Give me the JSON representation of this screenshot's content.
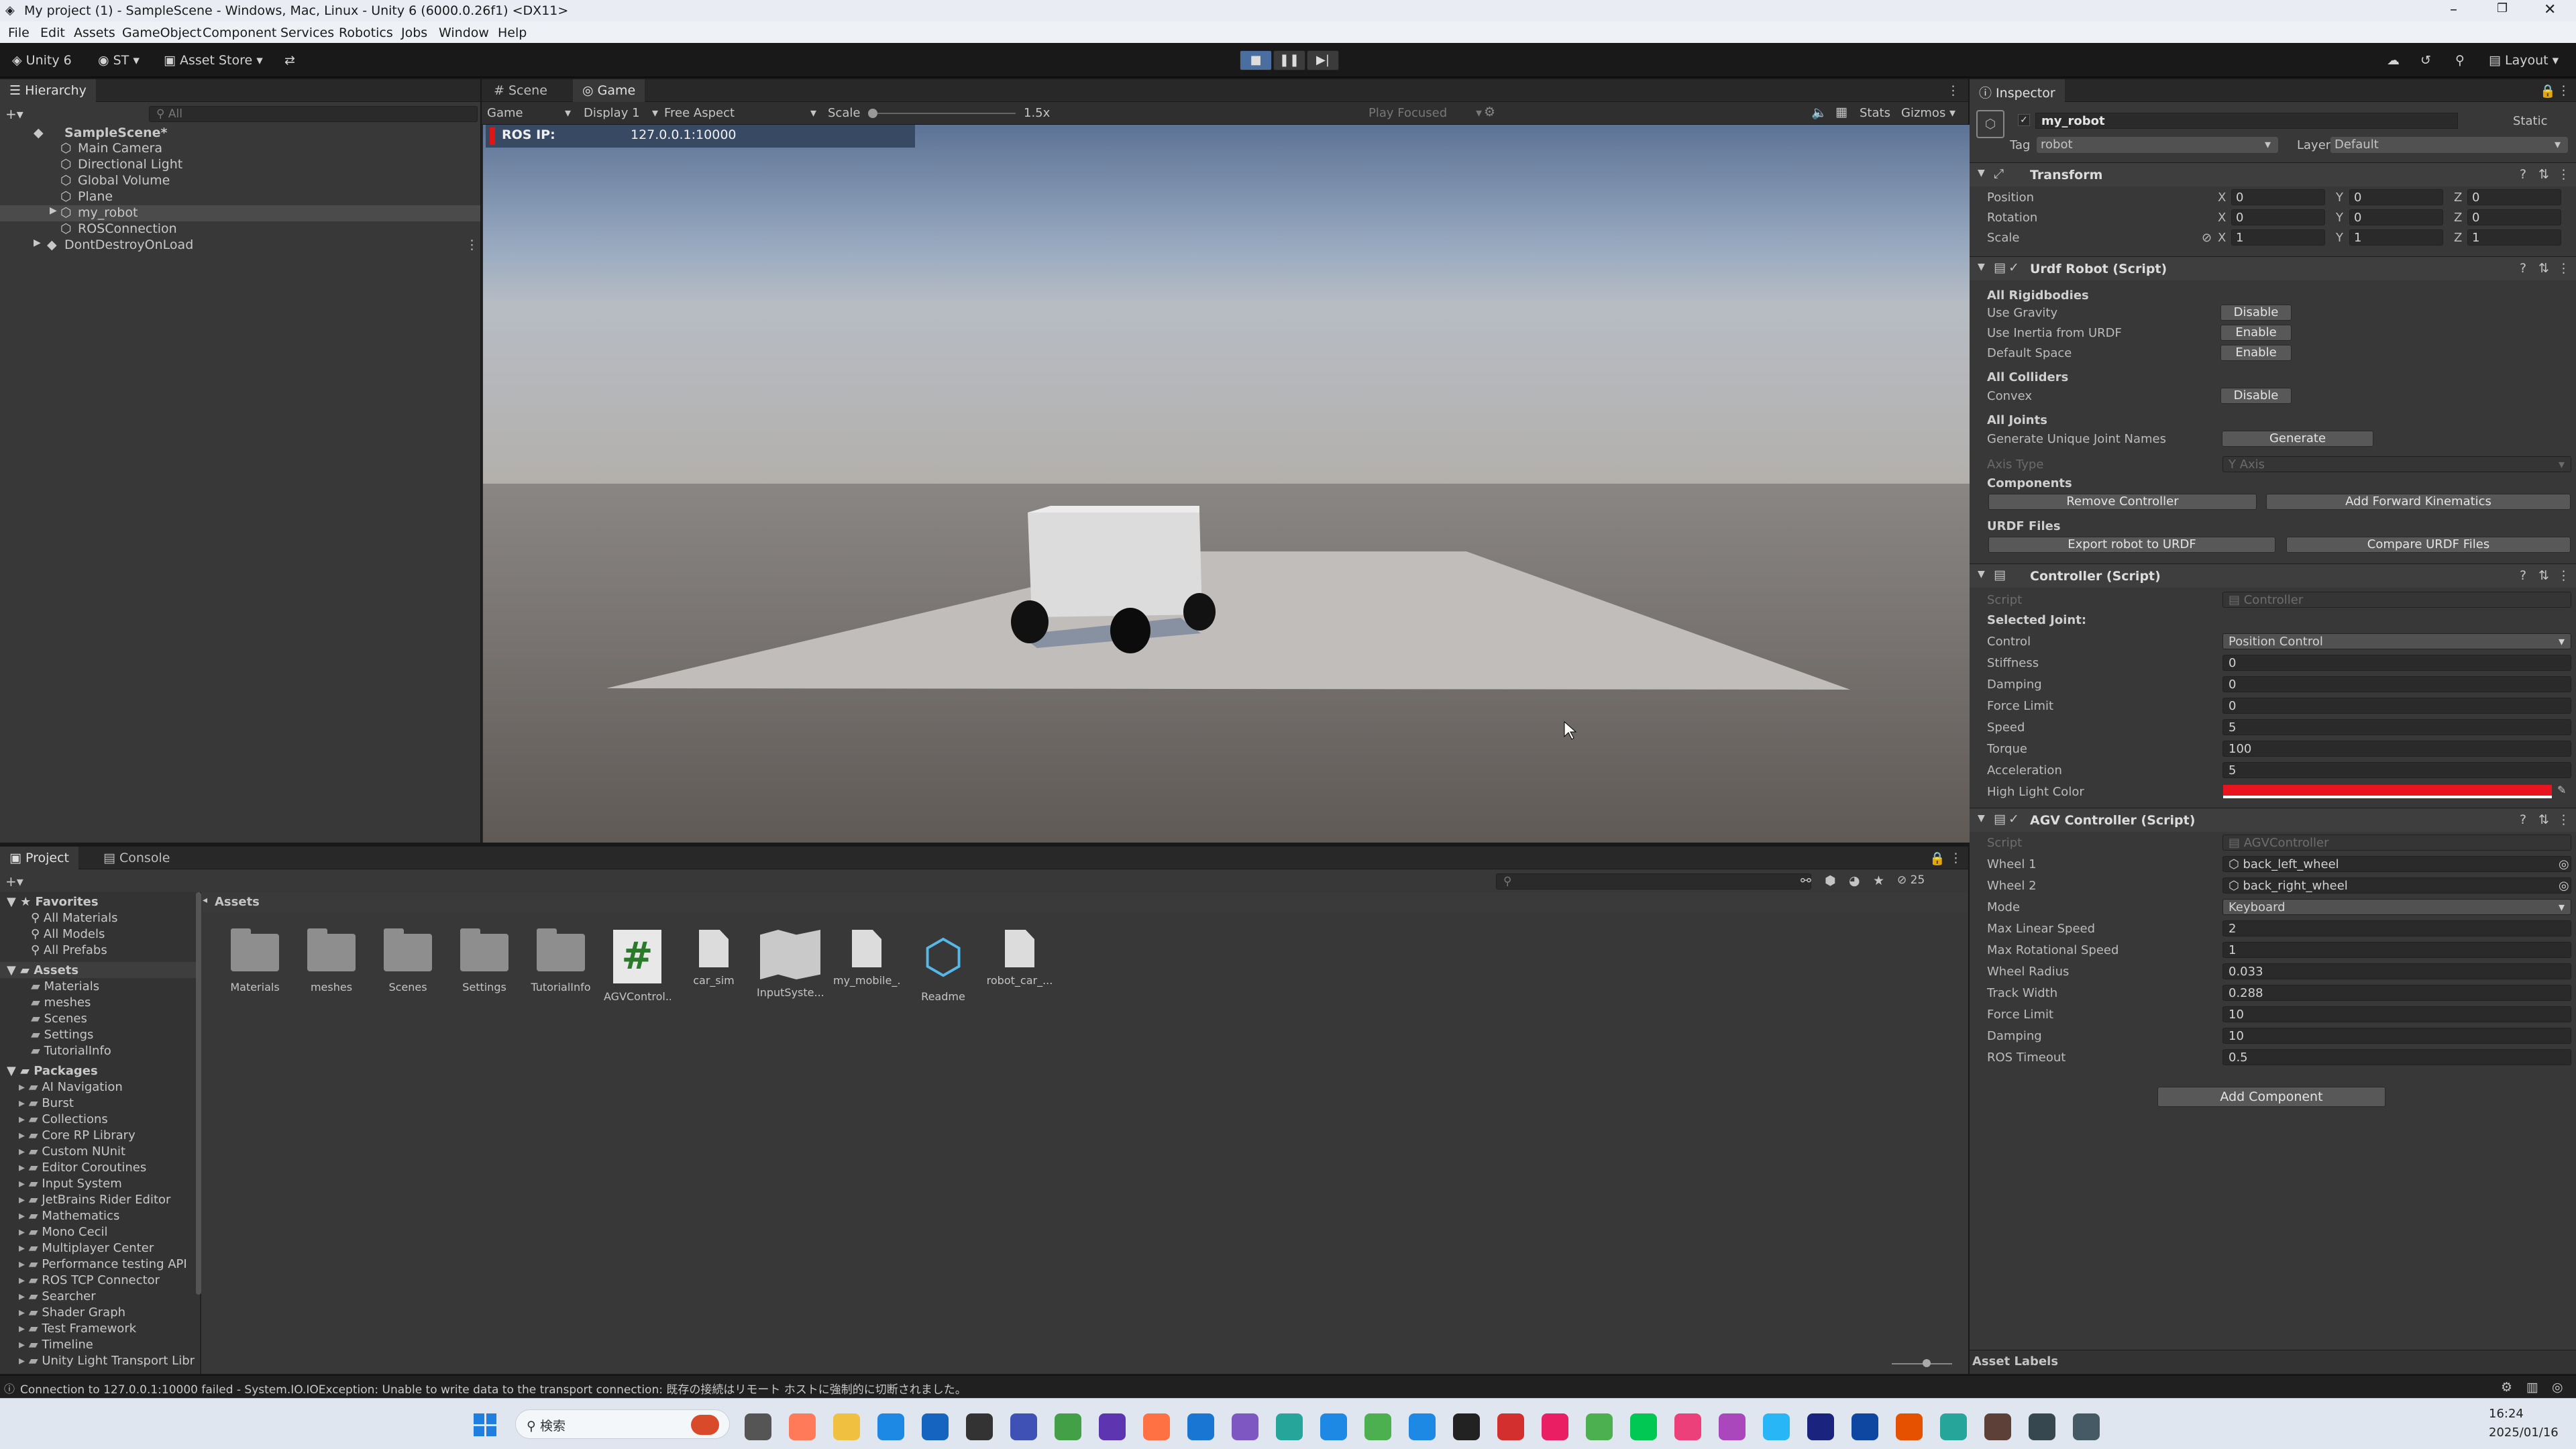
{
  "window": {
    "title": "My project (1) - SampleScene - Windows, Mac, Linux - Unity 6 (6000.0.26f1) <DX11>"
  },
  "menu": [
    "File",
    "Edit",
    "Assets",
    "GameObject",
    "Component",
    "Services",
    "Robotics",
    "Jobs",
    "Window",
    "Help"
  ],
  "toolbar": {
    "unity": "Unity 6",
    "account": "ST",
    "asset_store": "Asset Store",
    "layout": "Layout"
  },
  "hierarchy": {
    "tab": "Hierarchy",
    "search_placeholder": "All",
    "items": [
      {
        "label": "SampleScene*",
        "depth": 0
      },
      {
        "label": "Main Camera",
        "depth": 1
      },
      {
        "label": "Directional Light",
        "depth": 1
      },
      {
        "label": "Global Volume",
        "depth": 1
      },
      {
        "label": "Plane",
        "depth": 1
      },
      {
        "label": "my_robot",
        "depth": 1
      },
      {
        "label": "ROSConnection",
        "depth": 1
      },
      {
        "label": "DontDestroyOnLoad",
        "depth": 0
      }
    ]
  },
  "center": {
    "tabs": [
      "Scene",
      "Game"
    ],
    "game_mode": "Game",
    "display": "Display 1",
    "aspect": "Free Aspect",
    "scale_label": "Scale",
    "scale_value": "1.5x",
    "play_focused": "Play Focused",
    "stats": "Stats",
    "gizmos": "Gizmos",
    "ros_ip_label": "ROS IP:",
    "ros_ip_value": "127.0.0.1:10000"
  },
  "inspector": {
    "tab": "Inspector",
    "object_name": "my_robot",
    "static": "Static",
    "tag_label": "Tag",
    "tag": "robot",
    "layer_label": "Layer",
    "layer": "Default",
    "transform": {
      "title": "Transform",
      "position_label": "Position",
      "rotation_label": "Rotation",
      "scale_label": "Scale",
      "position": [
        "0",
        "0",
        "0"
      ],
      "rotation": [
        "0",
        "0",
        "0"
      ],
      "scale": [
        "1",
        "1",
        "1"
      ]
    },
    "urdf": {
      "title": "Urdf Robot (Script)",
      "all_rigidbodies": "All Rigidbodies",
      "use_gravity": "Use Gravity",
      "use_gravity_btn": "Disable",
      "use_inertia": "Use Inertia from URDF",
      "use_inertia_btn": "Enable",
      "default_space": "Default Space",
      "default_space_btn": "Enable",
      "all_colliders": "All Colliders",
      "convex": "Convex",
      "convex_btn": "Disable",
      "all_joints": "All Joints",
      "gen_names": "Generate Unique Joint Names",
      "gen_btn": "Generate",
      "axis_type": "Axis Type",
      "axis_value": "Y Axis",
      "components": "Components",
      "remove_ctrl": "Remove Controller",
      "add_fk": "Add Forward Kinematics",
      "urdf_files": "URDF Files",
      "export": "Export robot to URDF",
      "compare": "Compare URDF Files"
    },
    "controller": {
      "title": "Controller (Script)",
      "script_label": "Script",
      "script": "Controller",
      "selected_joint": "Selected Joint:",
      "fields": [
        {
          "label": "Control",
          "value": "Position Control"
        },
        {
          "label": "Stiffness",
          "value": "0"
        },
        {
          "label": "Damping",
          "value": "0"
        },
        {
          "label": "Force Limit",
          "value": "0"
        },
        {
          "label": "Speed",
          "value": "5"
        },
        {
          "label": "Torque",
          "value": "100"
        },
        {
          "label": "Acceleration",
          "value": "5"
        }
      ],
      "highlight_label": "High Light Color",
      "highlight_color": "#e8141e"
    },
    "agv": {
      "title": "AGV Controller (Script)",
      "script_label": "Script",
      "script": "AGVController",
      "fields": [
        {
          "label": "Wheel 1",
          "value": "back_left_wheel"
        },
        {
          "label": "Wheel 2",
          "value": "back_right_wheel"
        },
        {
          "label": "Mode",
          "value": "Keyboard"
        },
        {
          "label": "Max Linear Speed",
          "value": "2"
        },
        {
          "label": "Max Rotational Speed",
          "value": "1"
        },
        {
          "label": "Wheel Radius",
          "value": "0.033"
        },
        {
          "label": "Track Width",
          "value": "0.288"
        },
        {
          "label": "Force Limit",
          "value": "10"
        },
        {
          "label": "Damping",
          "value": "10"
        },
        {
          "label": "ROS Timeout",
          "value": "0.5"
        }
      ]
    },
    "add_component": "Add Component",
    "asset_labels": "Asset Labels"
  },
  "project": {
    "tabs": [
      "Project",
      "Console"
    ],
    "count": "25",
    "favorites_label": "Favorites",
    "favorites": [
      "All Materials",
      "All Models",
      "All Prefabs"
    ],
    "assets_label": "Assets",
    "asset_folders": [
      "Materials",
      "meshes",
      "Scenes",
      "Settings",
      "TutorialInfo"
    ],
    "packages_label": "Packages",
    "packages": [
      "AI Navigation",
      "Burst",
      "Collections",
      "Core RP Library",
      "Custom NUnit",
      "Editor Coroutines",
      "Input System",
      "JetBrains Rider Editor",
      "Mathematics",
      "Mono Cecil",
      "Multiplayer Center",
      "Performance testing API",
      "ROS TCP Connector",
      "Searcher",
      "Shader Graph",
      "Test Framework",
      "Timeline",
      "Unity Light Transport Libr"
    ],
    "breadcrumb": "Assets",
    "grid": [
      {
        "label": "Materials",
        "kind": "folder"
      },
      {
        "label": "meshes",
        "kind": "folder"
      },
      {
        "label": "Scenes",
        "kind": "folder"
      },
      {
        "label": "Settings",
        "kind": "folder"
      },
      {
        "label": "TutorialInfo",
        "kind": "folder"
      },
      {
        "label": "AGVControl...",
        "kind": "script"
      },
      {
        "label": "car_sim",
        "kind": "file"
      },
      {
        "label": "InputSyste...",
        "kind": "input"
      },
      {
        "label": "my_mobile_...",
        "kind": "file"
      },
      {
        "label": "Readme",
        "kind": "readme"
      },
      {
        "label": "robot_car_...",
        "kind": "file"
      }
    ]
  },
  "status": {
    "message": "Connection to 127.0.0.1:10000 failed - System.IO.IOException: Unable to write data to the transport connection: 既存の接続はリモート ホストに強制的に切断されました。"
  },
  "taskbar": {
    "search": "検索",
    "time": "16:24",
    "date": "2025/01/16"
  }
}
